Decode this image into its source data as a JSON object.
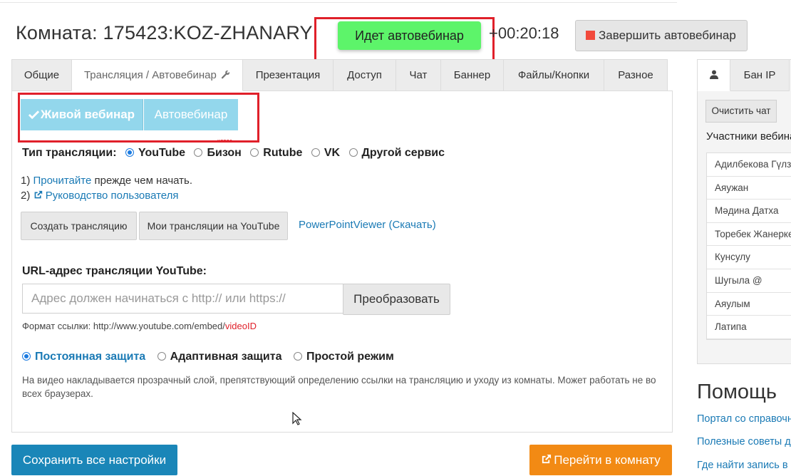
{
  "header": {
    "room_title": "Комната: 175423:KOZ-ZHANARY",
    "status_label": "Идет автовебинар",
    "timer": "+00:20:18",
    "finish_label": "Завершить автовебинар"
  },
  "tabs": [
    {
      "label": "Общие"
    },
    {
      "label": "Трансляция / Автовебинар"
    },
    {
      "label": "Презентация"
    },
    {
      "label": "Доступ"
    },
    {
      "label": "Чат"
    },
    {
      "label": "Баннер"
    },
    {
      "label": "Файлы/Кнопки"
    },
    {
      "label": "Разное"
    }
  ],
  "mode": {
    "live_label": "Живой вебинар",
    "auto_label": "Автовебинар",
    "new_tag": "новое"
  },
  "stream_type": {
    "label": "Тип трансляции:",
    "options": [
      "YouTube",
      "Бизон",
      "Rutube",
      "VK",
      "Другой сервис"
    ],
    "selected": "YouTube"
  },
  "steps": {
    "step1_num": "1)",
    "step1_link": "Прочитайте",
    "step1_text": " прежде чем начать.",
    "step2_num": "2)",
    "step2_link": "Руководство пользователя"
  },
  "actions": {
    "create_stream": "Создать трансляцию",
    "my_streams": "Мои трансляции на YouTube",
    "ppt_viewer": "PowerPointViewer (Скачать)"
  },
  "url": {
    "label": "URL-адрес трансляции YouTube:",
    "placeholder": "Адрес должен начинаться с http:// или https://",
    "value": "",
    "convert_label": "Преобразовать",
    "hint_prefix": "Формат ссылки: http://www.youtube.com/embed/",
    "hint_id": "videoID"
  },
  "protection": {
    "options": [
      "Постоянная защита",
      "Адаптивная защита",
      "Простой режим"
    ],
    "selected": "Постоянная защита",
    "description": "На видео накладывается прозрачный слой, препятствующий определению ссылки на трансляцию и уходу из комнаты. Может работать не во всех браузерах."
  },
  "footer": {
    "save_label": "Сохранить все настройки",
    "go_label": "Перейти в комнату"
  },
  "right": {
    "tab_ban": "Бан IP",
    "clear_chat": "Очистить чат",
    "participants_title": "Участники вебина",
    "participants": [
      "Адилбекова Гүлз",
      "Аяужан",
      "Мәдина Датха",
      "Торебек Жанерке",
      "Кунсулу",
      "Шугыла @",
      "Аяулым",
      "Латипа"
    ]
  },
  "help": {
    "title": "Помощь",
    "links": [
      "Портал со справочн",
      "Полезные советы д",
      "Где найти запись в"
    ]
  },
  "colors": {
    "status_green": "#5df46a",
    "highlight_red": "#e0202a",
    "mode_blue": "#93d7ec",
    "save_blue": "#1a86b8",
    "go_orange": "#f28a14",
    "link_blue": "#1a7ab5"
  },
  "icons": {
    "tab_wrench": "wrench-icon",
    "check": "check-icon",
    "external": "external-link-icon",
    "finish": "stop-square-icon",
    "user": "user-icon"
  }
}
